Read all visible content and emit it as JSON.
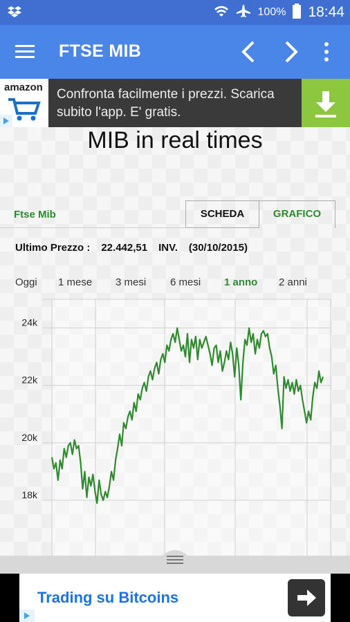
{
  "status": {
    "battery": "100%",
    "time": "18:44"
  },
  "appbar": {
    "title": "FTSE MIB"
  },
  "ad_top": {
    "brand": "amazon",
    "text": "Confronta facilmente i prezzi. Scarica subito l'app. E' gratis."
  },
  "page": {
    "heading": "MIB in real times",
    "section": "Ftse Mib",
    "tabs": {
      "scheda": "SCHEDA",
      "grafico": "GRAFICO"
    },
    "price": {
      "label": "Ultimo Prezzo :",
      "value": "22.442,51",
      "status": "INV.",
      "date": "(30/10/2015)"
    },
    "ranges": [
      "Oggi",
      "1 mese",
      "3 mesi",
      "6 mesi",
      "1 anno",
      "2 anni"
    ],
    "active_range": "1 anno"
  },
  "chart_data": {
    "type": "line",
    "color": "#2e8b2e",
    "ylim": [
      16000,
      25000
    ],
    "yticks": [
      18000,
      20000,
      22000,
      24000
    ],
    "ytick_labels": [
      "18k",
      "20k",
      "22k",
      "24k"
    ],
    "series": [
      {
        "values": [
          19500,
          19100,
          19300,
          18700,
          19400,
          19100,
          19800,
          19500,
          19900,
          20000,
          19600,
          20100,
          19800,
          19900,
          19300,
          18400,
          19000,
          18100,
          18800,
          18500,
          18900,
          18300,
          17900,
          18700,
          18200,
          18000,
          18300,
          18100,
          18500,
          19000,
          18700,
          19400,
          19800,
          20300,
          19900,
          20700,
          20500,
          20900,
          21100,
          20800,
          21400,
          21100,
          21700,
          21500,
          21900,
          22100,
          21800,
          22300,
          22500,
          22200,
          22600,
          22800,
          22400,
          22900,
          23100,
          22800,
          23400,
          23200,
          23600,
          23800,
          23500,
          24000,
          23600,
          23200,
          23400,
          23000,
          23800,
          22800,
          23600,
          23300,
          23700,
          22900,
          23600,
          23300,
          23500,
          23700,
          23400,
          23100,
          22700,
          23300,
          23400,
          22800,
          23200,
          22500,
          22800,
          23200,
          22900,
          23500,
          23100,
          22300,
          23300,
          22700,
          21500,
          22800,
          23600,
          23400,
          24000,
          23500,
          23800,
          23100,
          23600,
          23300,
          23800,
          23900,
          23700,
          23800,
          23300,
          23000,
          22400,
          22700,
          21900,
          21300,
          20500,
          22300,
          21900,
          22200,
          21800,
          22100,
          21700,
          22200,
          21800,
          22000,
          21500,
          21100,
          20700,
          21100,
          20800,
          21600,
          22100,
          21900,
          22500,
          22100,
          22300
        ]
      }
    ]
  }
}
